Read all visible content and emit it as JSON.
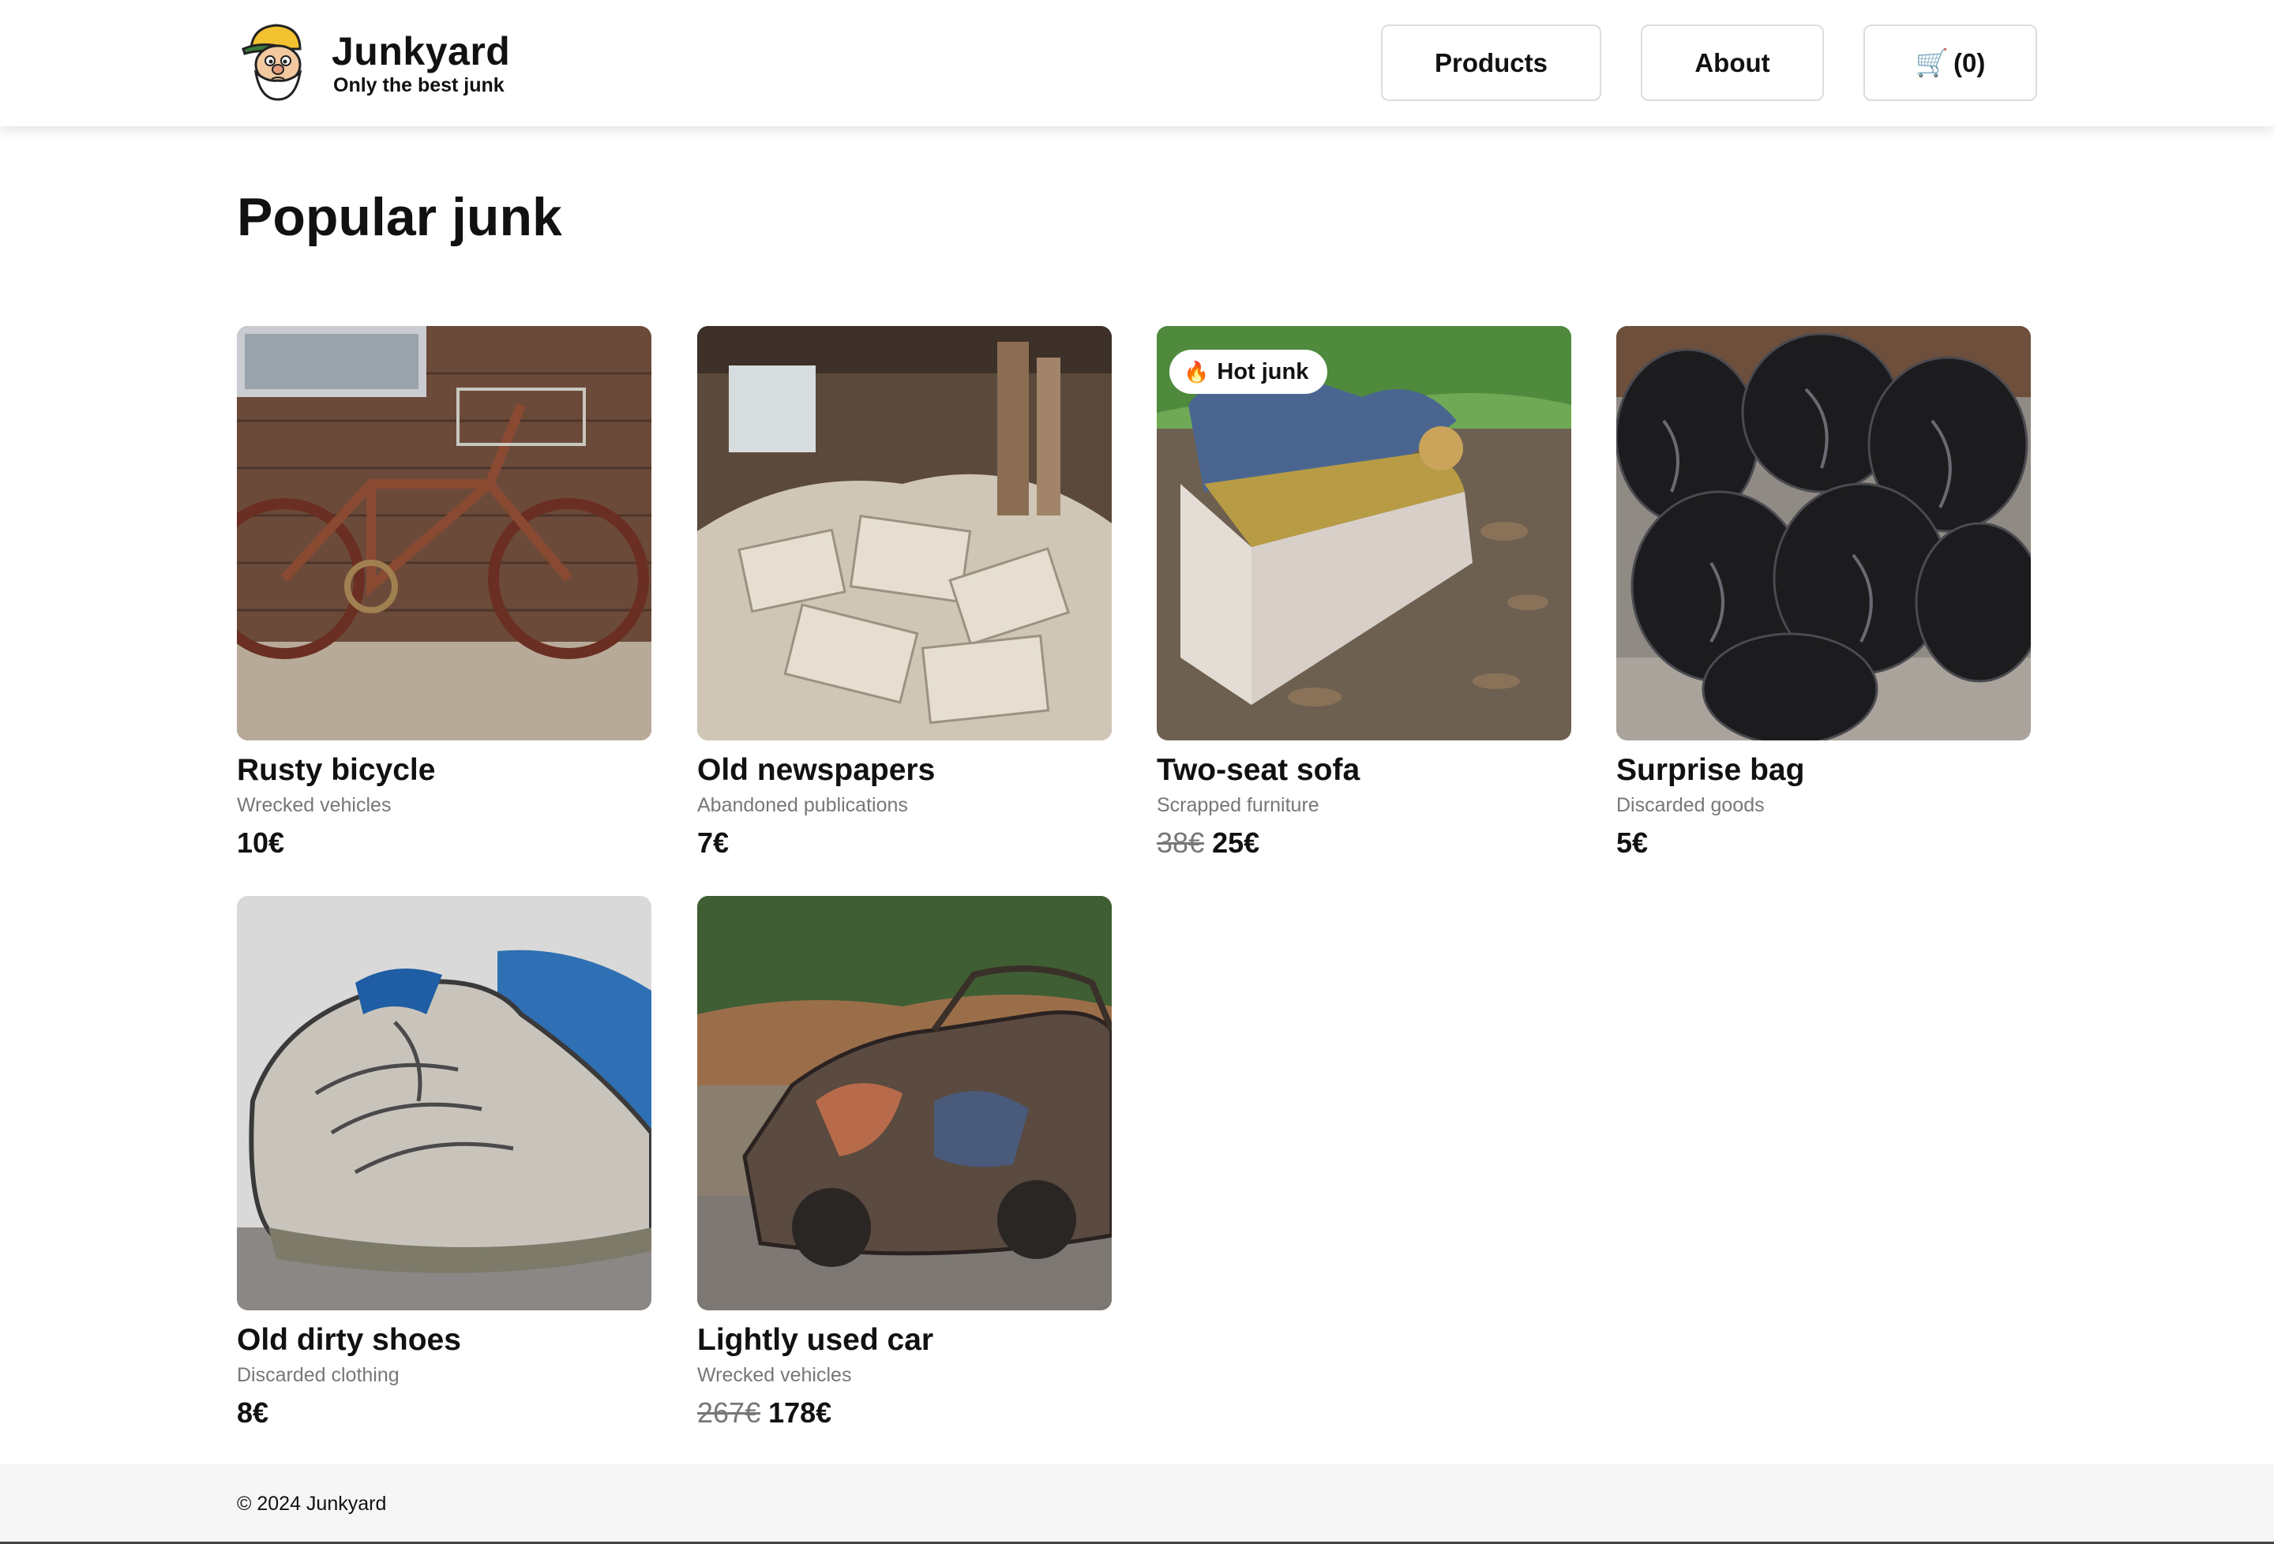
{
  "header": {
    "brand_name": "Junkyard",
    "tagline": "Only the best junk",
    "nav": {
      "products": "Products",
      "about": "About",
      "cart_icon": "🛒",
      "cart_count": "(0)"
    }
  },
  "main": {
    "title": "Popular junk",
    "products": [
      {
        "title": "Rusty bicycle",
        "category": "Wrecked vehicles",
        "price": "10€",
        "old_price": "",
        "badge": "",
        "image": "bicycle-photo"
      },
      {
        "title": "Old newspapers",
        "category": "Abandoned publications",
        "price": "7€",
        "old_price": "",
        "badge": "",
        "image": "newspapers-photo"
      },
      {
        "title": "Two-seat sofa",
        "category": "Scrapped furniture",
        "price": "25€",
        "old_price": "38€",
        "badge": "Hot junk",
        "badge_icon": "🔥",
        "image": "sofa-photo"
      },
      {
        "title": "Surprise bag",
        "category": "Discarded goods",
        "price": "5€",
        "old_price": "",
        "badge": "",
        "image": "trash-bags-photo"
      },
      {
        "title": "Old dirty shoes",
        "category": "Discarded clothing",
        "price": "8€",
        "old_price": "",
        "badge": "",
        "image": "shoes-photo"
      },
      {
        "title": "Lightly used car",
        "category": "Wrecked vehicles",
        "price": "178€",
        "old_price": "267€",
        "badge": "",
        "image": "burnt-car-photo"
      }
    ]
  },
  "footer": {
    "copyright": "© 2024 Junkyard"
  }
}
